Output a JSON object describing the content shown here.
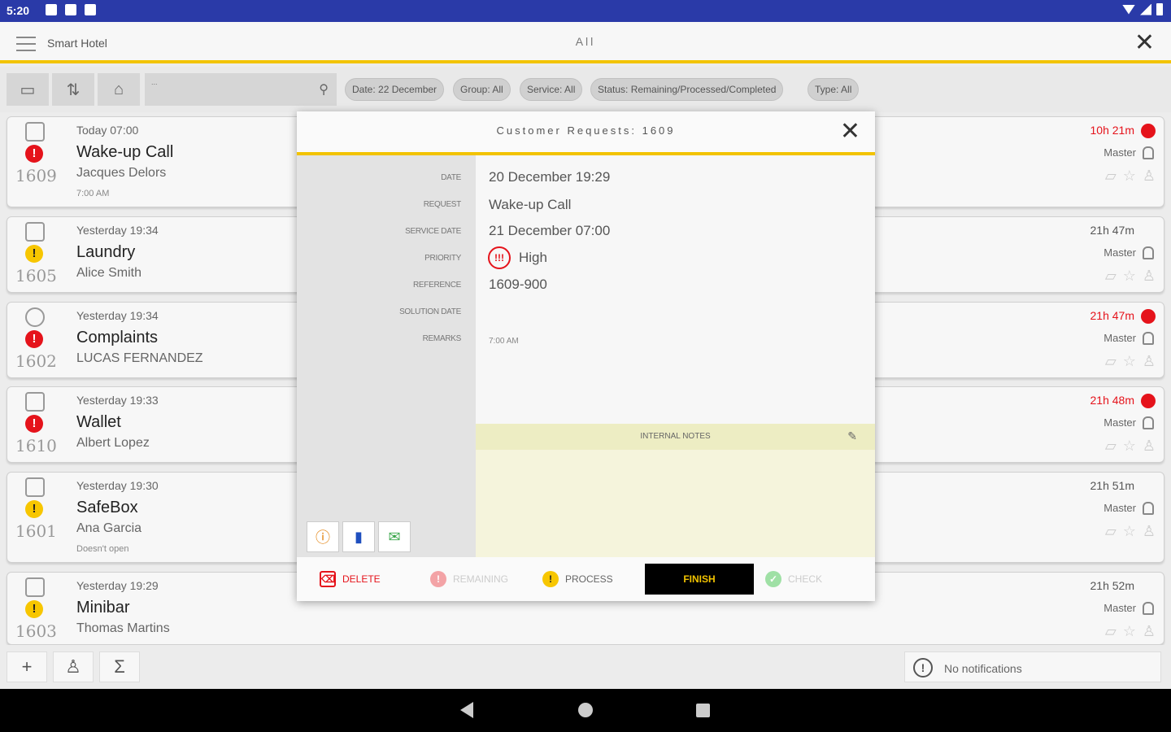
{
  "status_bar": {
    "time": "5:20"
  },
  "app": {
    "title": "Smart Hotel",
    "center_title": "All"
  },
  "toolbar": {
    "search_placeholder": "...",
    "filters": [
      "Date: 22 December",
      "Group: All",
      "Service: All",
      "Status: Remaining/Processed/Completed",
      "Type: All"
    ]
  },
  "requests": [
    {
      "time": "Today 07:00",
      "title": "Wake-up Call",
      "guest": "Jacques Delors",
      "note": "7:00 AM",
      "room": "1609",
      "priority": "high",
      "elapsed": "10h 21m",
      "elapsed_alert": true,
      "owner": "Master"
    },
    {
      "time": "Yesterday 19:34",
      "title": "Laundry",
      "guest": "Alice Smith",
      "note": "",
      "room": "1605",
      "priority": "medium",
      "elapsed": "21h 47m",
      "elapsed_alert": false,
      "owner": "Master"
    },
    {
      "time": "Yesterday 19:34",
      "title": "Complaints",
      "guest": "LUCAS FERNANDEZ",
      "note": "",
      "room": "1602",
      "priority": "high",
      "elapsed": "21h 47m",
      "elapsed_alert": true,
      "owner": "Master"
    },
    {
      "time": "Yesterday 19:33",
      "title": "Wallet",
      "guest": "Albert Lopez",
      "note": "",
      "room": "1610",
      "priority": "high",
      "elapsed": "21h 48m",
      "elapsed_alert": true,
      "owner": "Master"
    },
    {
      "time": "Yesterday 19:30",
      "title": "SafeBox",
      "guest": "Ana Garcia",
      "note": "Doesn't open",
      "room": "1601",
      "priority": "medium",
      "elapsed": "21h 51m",
      "elapsed_alert": false,
      "owner": "Master"
    },
    {
      "time": "Yesterday 19:29",
      "title": "Minibar",
      "guest": "Thomas Martins",
      "note": "",
      "room": "1603",
      "priority": "medium",
      "elapsed": "21h 52m",
      "elapsed_alert": false,
      "owner": "Master"
    }
  ],
  "modal": {
    "title": "Customer Requests: 1609",
    "labels": {
      "date": "DATE",
      "request": "REQUEST",
      "service_date": "SERVICE DATE",
      "priority": "PRIORITY",
      "reference": "REFERENCE",
      "solution_date": "SOLUTION DATE",
      "remarks": "REMARKS"
    },
    "values": {
      "date": "20 December 19:29",
      "request": "Wake-up Call",
      "service_date": "21 December 07:00",
      "priority": "High",
      "priority_symbol": "!!!",
      "reference": "1609-900",
      "solution_date": "",
      "remarks": "7:00 AM"
    },
    "internal_notes_label": "INTERNAL NOTES",
    "actions": {
      "delete": "DELETE",
      "remaining": "REMAINING",
      "process": "PROCESS",
      "finish": "FINISH",
      "check": "CHECK"
    }
  },
  "notifications": {
    "text": "No notifications"
  },
  "colors": {
    "accent": "#f2c300",
    "status_bar": "#2a3aa8",
    "alert_red": "#e5131b",
    "medium_yellow": "#f7c600"
  }
}
